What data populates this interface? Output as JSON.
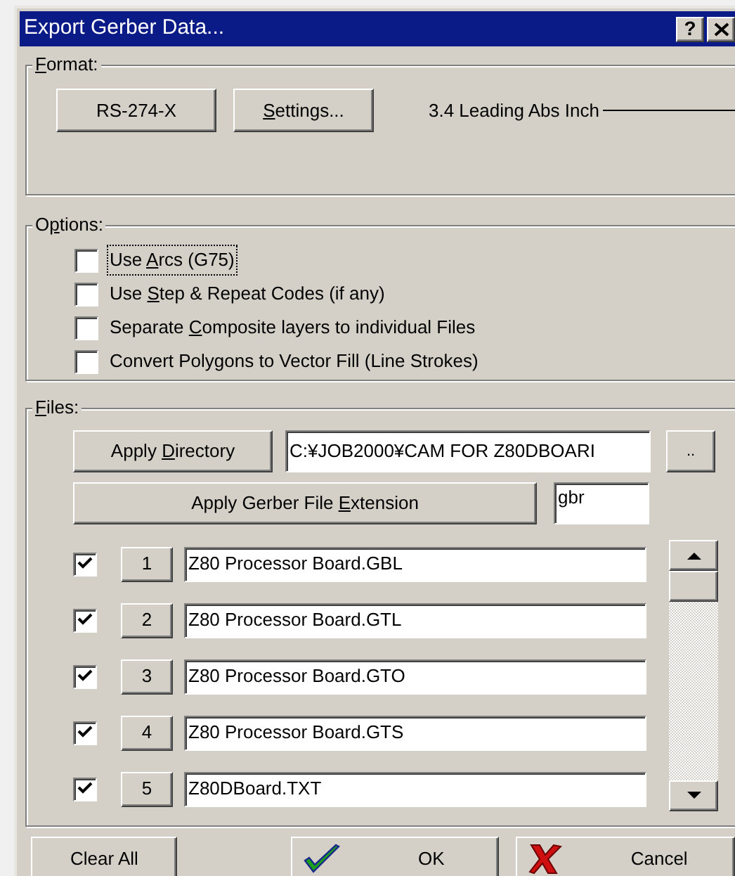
{
  "window": {
    "title": "Export Gerber Data...",
    "help_button": "?"
  },
  "format": {
    "label": {
      "key": "F",
      "post": "ormat:"
    },
    "buttons": [
      {
        "pre": "RS-274-X"
      },
      {
        "key": "S",
        "post": "ettings..."
      }
    ],
    "description": "3.4 Leading Abs Inch"
  },
  "options": {
    "label": {
      "pre": "O",
      "key": "p",
      "post": "tions:"
    },
    "items": [
      {
        "pre": "Use ",
        "key": "A",
        "post": "rcs (G75)",
        "checked": false,
        "focused": true
      },
      {
        "pre": "Use ",
        "key": "S",
        "post": "tep & Repeat Codes (if any)",
        "checked": false,
        "focused": false
      },
      {
        "pre": "Separate ",
        "key": "C",
        "post": "omposite layers to individual Files",
        "checked": false,
        "focused": false
      },
      {
        "pre": "Convert Polygons to Vector Fill (Line Strokes)",
        "checked": false,
        "focused": false
      }
    ]
  },
  "files": {
    "label": {
      "key": "F",
      "post": "iles:"
    },
    "apply_directory": {
      "pre": "Apply ",
      "key": "D",
      "post": "irectory"
    },
    "directory": "C:¥JOB2000¥CAM FOR Z80DBOARI",
    "browse_button": "..",
    "apply_extension": {
      "pre": "Apply Gerber File ",
      "key": "E",
      "post": "xtension"
    },
    "extension": "gbr",
    "rows": [
      {
        "checked": true,
        "number": "1",
        "file": "Z80 Processor Board.GBL"
      },
      {
        "checked": true,
        "number": "2",
        "file": "Z80 Processor Board.GTL"
      },
      {
        "checked": true,
        "number": "3",
        "file": "Z80 Processor Board.GTO"
      },
      {
        "checked": true,
        "number": "4",
        "file": "Z80 Processor Board.GTS"
      },
      {
        "checked": true,
        "number": "5",
        "file": "Z80DBoard.TXT"
      }
    ]
  },
  "footer": [
    {
      "kind": "plain",
      "label": "Clear All"
    },
    {
      "kind": "ok",
      "label": "OK"
    },
    {
      "kind": "cancel",
      "label": "Cancel"
    }
  ]
}
